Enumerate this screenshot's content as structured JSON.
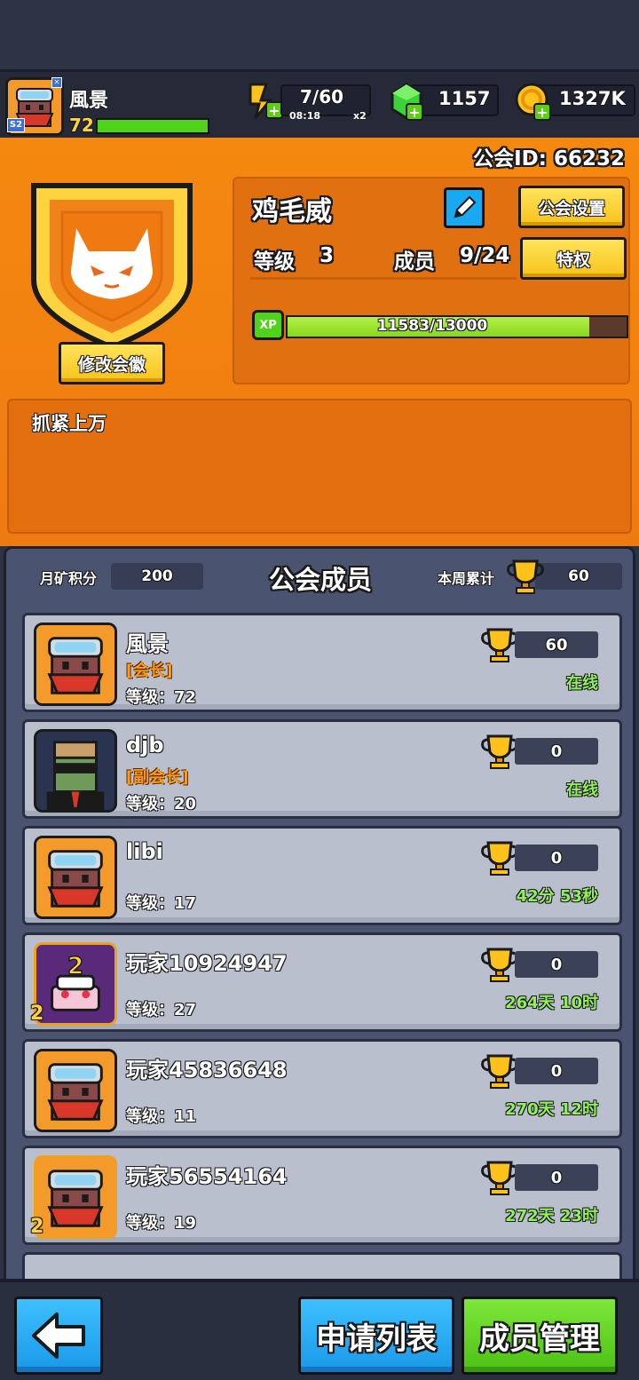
{
  "player": {
    "name": "風景",
    "level": "72",
    "season_badge": "S2"
  },
  "resources": {
    "energy_value": "7/60",
    "energy_timer": "08:18",
    "energy_mult": "x2",
    "gems": "1157",
    "coins": "1327K"
  },
  "guild": {
    "id_label": "公会ID: 66232",
    "name": "鸡毛威",
    "level_label": "等级",
    "level": "3",
    "members_label": "成员",
    "members": "9/24",
    "settings_button": "公会设置",
    "privilege_button": "特权",
    "edit_emblem_button": "修改会徽",
    "xp_badge": "XP",
    "xp_text": "11583/13000",
    "xp_fraction": 0.891,
    "motto": "抓紧上万"
  },
  "members_panel": {
    "title": "公会成员",
    "monthly_label": "月矿积分",
    "monthly_value": "200",
    "weekly_label": "本周累计",
    "weekly_value": "60"
  },
  "members": [
    {
      "name": "風景",
      "title": "[会长]",
      "level": "等级：72",
      "score": "60",
      "status": "在线"
    },
    {
      "name": "djb",
      "title": "[副会长]",
      "level": "等级：20",
      "score": "0",
      "status": "在线"
    },
    {
      "name": "libi",
      "title": "",
      "level": "等级：17",
      "score": "0",
      "status": "42分 53秒"
    },
    {
      "name": "玩家10924947",
      "title": "",
      "level": "等级：27",
      "score": "0",
      "status": "264天 10时"
    },
    {
      "name": "玩家45836648",
      "title": "",
      "level": "等级：11",
      "score": "0",
      "status": "270天 12时"
    },
    {
      "name": "玩家56554164",
      "title": "",
      "level": "等级：19",
      "score": "0",
      "status": "272天 23时"
    }
  ],
  "bottom": {
    "apply_list": "申请列表",
    "member_manage": "成员管理"
  },
  "colors": {
    "orange": "#f07a10",
    "yellow_button": "#f7c21a",
    "blue_button": "#1aa8f0",
    "green_button": "#5ccf14",
    "online_green": "#8ff25a",
    "title_orange": "#ff9a1a"
  }
}
